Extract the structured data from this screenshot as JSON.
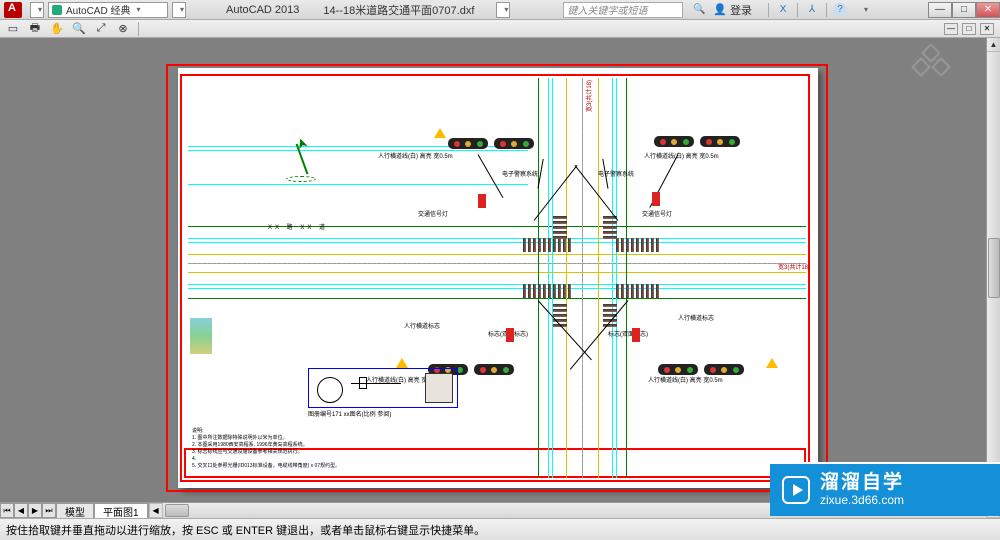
{
  "titlebar": {
    "workspace_label": "AutoCAD 经典",
    "app_name": "AutoCAD 2013",
    "file_name": "14--18米道路交通平面0707.dxf",
    "search_placeholder": "键入关键字或短语",
    "login_label": "登录",
    "win_min": "—",
    "win_max": "□",
    "win_close": "✕",
    "icon_x": "X",
    "icon_share": "⅄",
    "icon_help": "?"
  },
  "toolbar": {
    "doc_min": "—",
    "doc_max": "□",
    "doc_close": "✕"
  },
  "tabs": {
    "arrow_first": "⏮",
    "arrow_prev": "◀",
    "arrow_next": "▶",
    "arrow_last": "⏭",
    "model": "模型",
    "layout1": "平面图1"
  },
  "status": {
    "hint": "按住拾取键并垂直拖动以进行缩放，按 ESC 或 ENTER 键退出，或者单击鼠标右键显示快捷菜单。"
  },
  "watermark": {
    "cn": "溜溜自学",
    "url": "zixue.3d66.com"
  },
  "drawing": {
    "label_placeholder": "人行横道线(白) 高亮 宽0.5m",
    "annot1": "电子警察系统",
    "annot2": "交通信号灯",
    "annot3": "人行横道标志",
    "annot4": "标志(双面标志)",
    "road_label": "XX 路 XX 道",
    "notes_title": "说明:",
    "note1": "1. 图中所注数据除特殊说明外以米为单位。",
    "note2": "2. 本图采用1980西安高程系, 1996年黄岛高程系统。",
    "note3": "3. 标志标线应与交通设施设备参考相关规范执行。",
    "note4": "4.",
    "note5": "5. 交叉口处参照光栅(ID013标准设备，电缆线带角度) x 07规约型。",
    "dim1": "宽3(共计18)",
    "dim2": "宽3(共计18)"
  }
}
